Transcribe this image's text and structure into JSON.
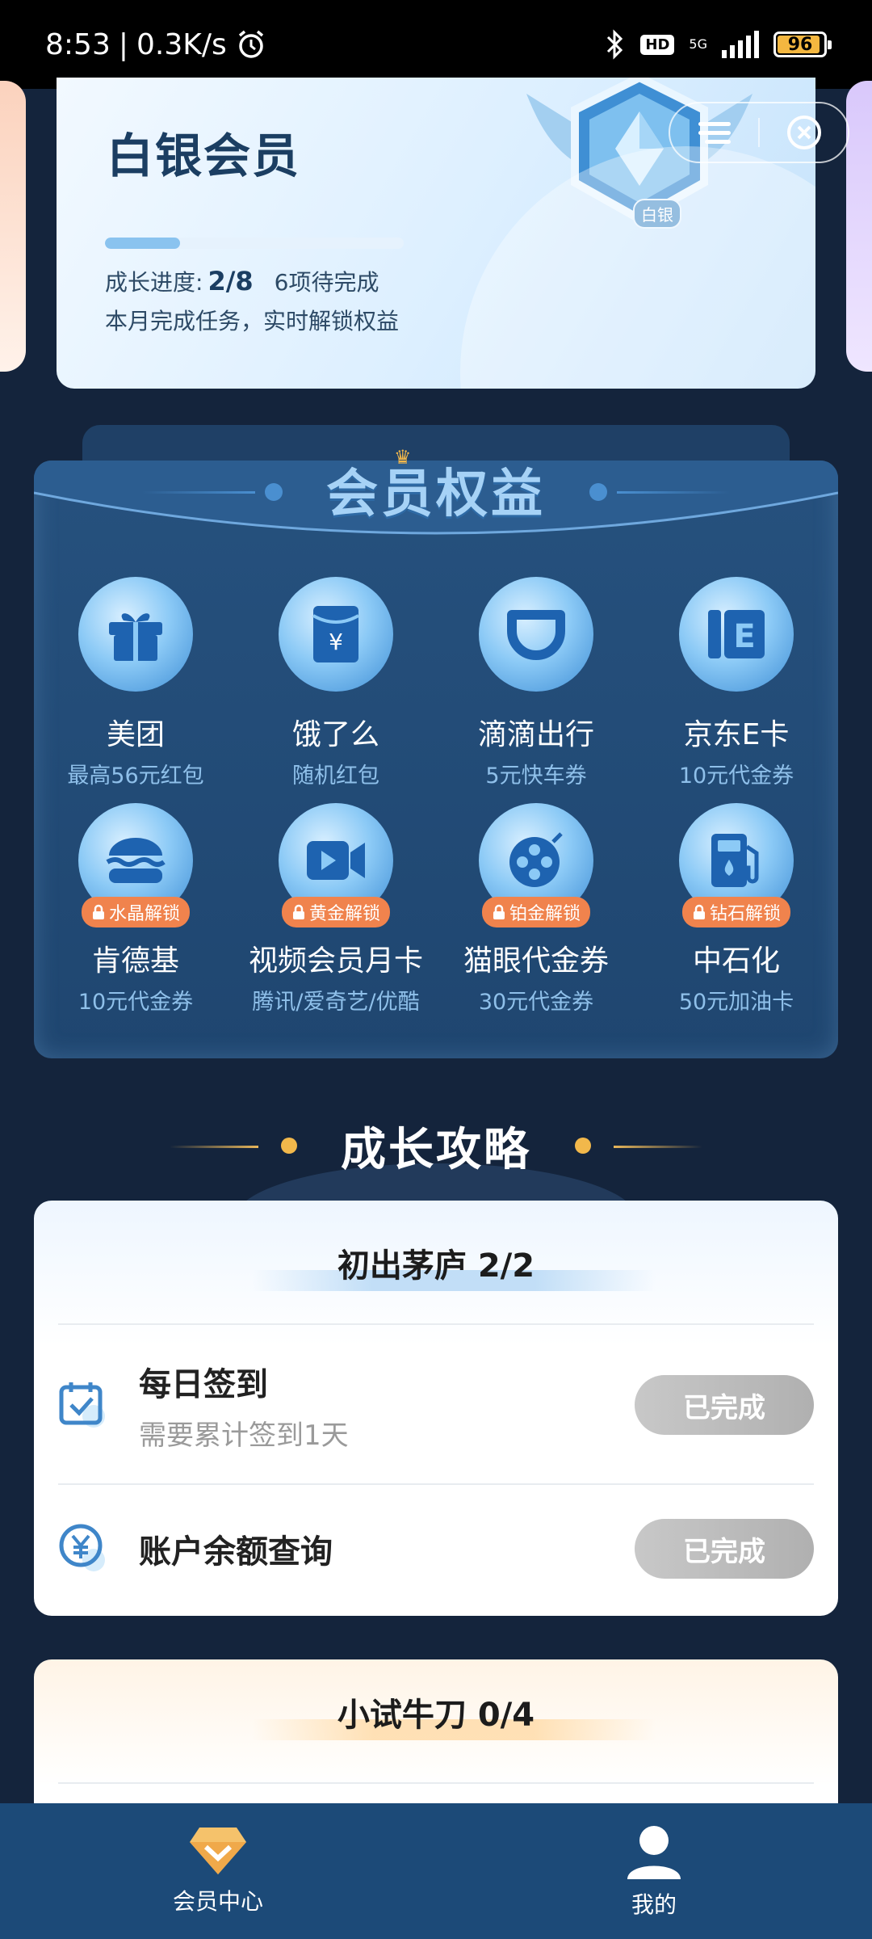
{
  "status_bar": {
    "time": "8:53",
    "speed": "0.3K/s",
    "network": "5G",
    "hd": "HD",
    "battery": "96"
  },
  "member_card": {
    "level": "白银会员",
    "badge_label": "白银",
    "progress_label": "成长进度:",
    "progress_value": "2/8",
    "progress_fraction": 0.25,
    "pending_text": "6项待完成",
    "tip": "本月完成任务，实时解锁权益"
  },
  "benefits": {
    "title": "会员权益",
    "items": [
      {
        "name": "美团",
        "sub": "最高56元红包",
        "icon": "gift-icon"
      },
      {
        "name": "饿了么",
        "sub": "随机红包",
        "icon": "red-packet-icon"
      },
      {
        "name": "滴滴出行",
        "sub": "5元快车券",
        "icon": "didi-icon"
      },
      {
        "name": "京东E卡",
        "sub": "10元代金券",
        "icon": "e-card-icon"
      },
      {
        "name": "肯德基",
        "sub": "10元代金券",
        "icon": "burger-icon",
        "lock": "水晶解锁"
      },
      {
        "name": "视频会员月卡",
        "sub": "腾讯/爱奇艺/优酷",
        "icon": "video-camera-icon",
        "lock": "黄金解锁"
      },
      {
        "name": "猫眼代金券",
        "sub": "30元代金券",
        "icon": "film-reel-icon",
        "lock": "铂金解锁"
      },
      {
        "name": "中石化",
        "sub": "50元加油卡",
        "icon": "fuel-pump-icon",
        "lock": "钻石解锁"
      }
    ]
  },
  "growth": {
    "title": "成长攻略",
    "groups": [
      {
        "title": "初出茅庐 2/2",
        "tasks": [
          {
            "name": "每日签到",
            "desc": "需要累计签到1天",
            "button": "已完成",
            "icon": "calendar-check-icon"
          },
          {
            "name": "账户余额查询",
            "desc": "",
            "button": "已完成",
            "icon": "yuan-coin-icon"
          }
        ]
      },
      {
        "title": "小试牛刀 0/4",
        "tasks": []
      }
    ]
  },
  "nav": {
    "items": [
      {
        "label": "会员中心",
        "icon": "diamond-icon",
        "active": true
      },
      {
        "label": "我的",
        "icon": "user-icon",
        "active": false
      }
    ]
  }
}
